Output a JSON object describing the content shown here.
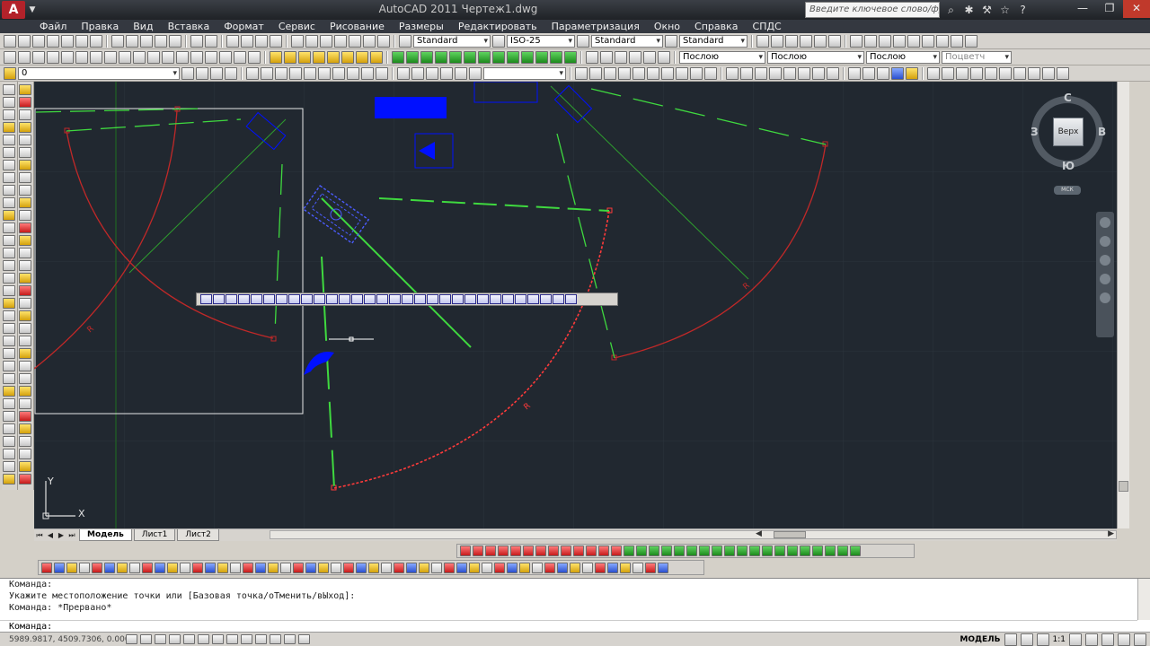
{
  "title_bar": {
    "app_logo": "A",
    "title": "AutoCAD 2011   Чертеж1.dwg",
    "search_placeholder": "Введите ключевое слово/фразу",
    "buttons": [
      "binoculars-icon",
      "star-icon",
      "help-icon"
    ]
  },
  "menu": [
    "Файл",
    "Правка",
    "Вид",
    "Вставка",
    "Формат",
    "Сервис",
    "Рисование",
    "Размеры",
    "Редактировать",
    "Параметризация",
    "Окно",
    "Справка",
    "СПДС"
  ],
  "toolbar1": {
    "text_style": "Standard",
    "dim_style": "ISO-25",
    "table_style": "Standard",
    "mleader_style": "Standard"
  },
  "toolbar2": {
    "color": "Послою",
    "linetype": "Послою",
    "lineweight": "Послою",
    "plotstyle": "Поцветч"
  },
  "toolbar3": {
    "layer": "0"
  },
  "viewcube": {
    "face": "Верх",
    "north": "С",
    "south": "Ю",
    "west": "З",
    "east": "В",
    "ucs": "МСК"
  },
  "ucs_icon": {
    "x_label": "X",
    "y_label": "Y"
  },
  "dimensions": {
    "radius_label": "R"
  },
  "tabs": [
    "Модель",
    "Лист1",
    "Лист2"
  ],
  "command": {
    "history": [
      "Команда:",
      "Укажите местоположение точки или [Базовая точка/оТменить/вЫход]:",
      "Команда: *Прервано*"
    ],
    "prompt": "Команда:"
  },
  "status": {
    "coordinates": "5989.9817, 4509.7306, 0.0000",
    "model": "МОДЕЛЬ",
    "scale": "1:1"
  },
  "colors": {
    "canvas": "#212830",
    "red_geometry": "#c02828",
    "green_geometry": "#3fd93f",
    "selection_blue": "#0010ff"
  }
}
